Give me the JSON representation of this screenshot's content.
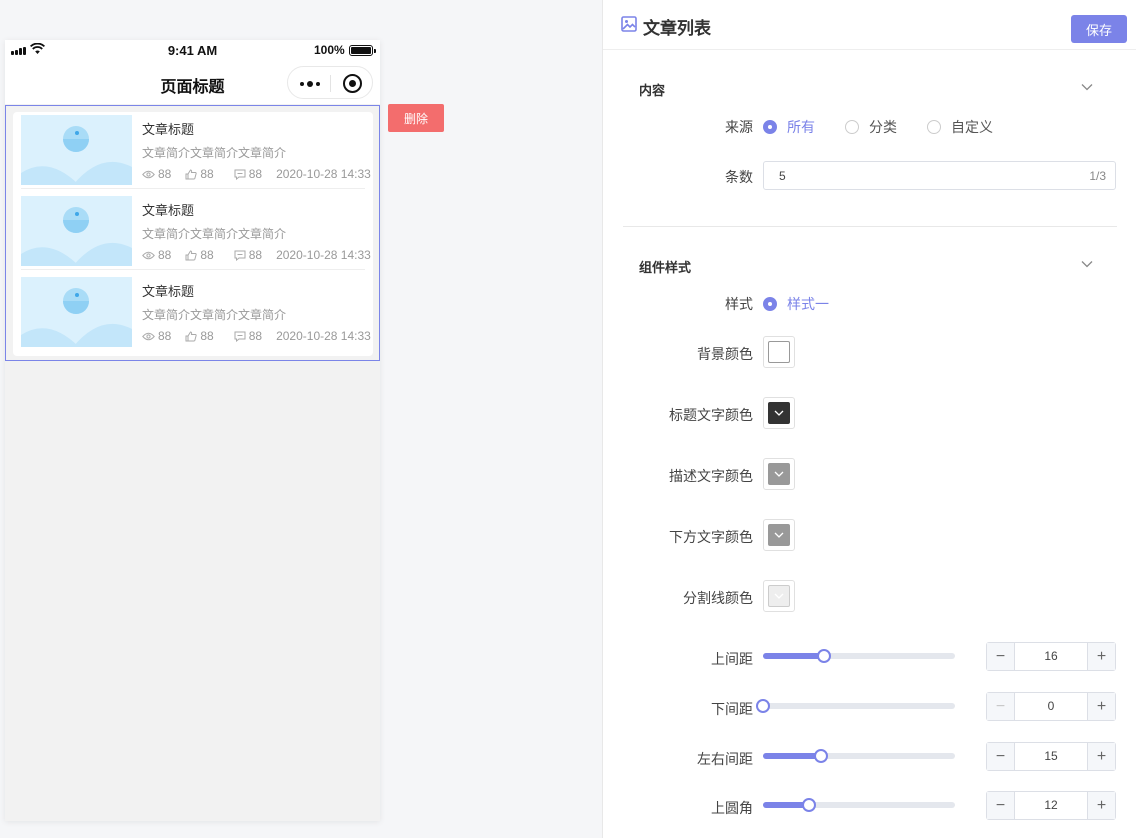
{
  "phone": {
    "status": {
      "time": "9:41 AM",
      "battery": "100%"
    },
    "nav_title": "页面标题",
    "articles": [
      {
        "title": "文章标题",
        "desc": "文章简介文章简介文章简介",
        "views": "88",
        "likes": "88",
        "comments": "88",
        "date": "2020-10-28 14:33"
      },
      {
        "title": "文章标题",
        "desc": "文章简介文章简介文章简介",
        "views": "88",
        "likes": "88",
        "comments": "88",
        "date": "2020-10-28 14:33"
      },
      {
        "title": "文章标题",
        "desc": "文章简介文章简介文章简介",
        "views": "88",
        "likes": "88",
        "comments": "88",
        "date": "2020-10-28 14:33"
      }
    ],
    "delete_label": "删除"
  },
  "panel": {
    "title": "文章列表",
    "save_label": "保存",
    "content_section": {
      "title": "内容",
      "source_label": "来源",
      "source_options": [
        "所有",
        "分类",
        "自定义"
      ],
      "source_selected": "所有",
      "count_label": "条数",
      "count_value": "5",
      "count_limit": "1/3"
    },
    "style_section": {
      "title": "组件样式",
      "style_label": "样式",
      "style_options": [
        "样式一"
      ],
      "style_selected": "样式一",
      "bg_color_label": "背景颜色",
      "title_color_label": "标题文字颜色",
      "desc_color_label": "描述文字颜色",
      "bottom_color_label": "下方文字颜色",
      "divider_color_label": "分割线颜色",
      "colors": {
        "background": "#ffffff",
        "title_text": "#333333",
        "desc_text": "#999999",
        "bottom_text": "#999999",
        "divider": "#eeeeee"
      },
      "sliders": [
        {
          "label": "上间距",
          "value": "16",
          "fraction": 0.32
        },
        {
          "label": "下间距",
          "value": "0",
          "fraction": 0.0
        },
        {
          "label": "左右间距",
          "value": "15",
          "fraction": 0.3
        },
        {
          "label": "上圆角",
          "value": "12",
          "fraction": 0.24
        }
      ]
    }
  },
  "theme": {
    "accent": "#7b83e8",
    "danger": "#f36d6d"
  }
}
